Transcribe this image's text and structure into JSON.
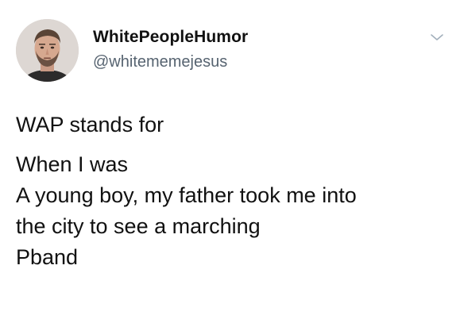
{
  "tweet": {
    "author": {
      "display_name": "WhitePeopleHumor",
      "handle": "@whitememejesus",
      "avatar_icon": "profile-photo"
    },
    "menu_icon": "chevron-down-icon",
    "text_lines": [
      "WAP stands for",
      "When I was",
      "A young boy, my father took me into",
      "the city to see a marching",
      "Pband"
    ]
  },
  "colors": {
    "text": "#111111",
    "handle": "#566370",
    "chevron": "#a3b0bc",
    "background": "#ffffff"
  }
}
